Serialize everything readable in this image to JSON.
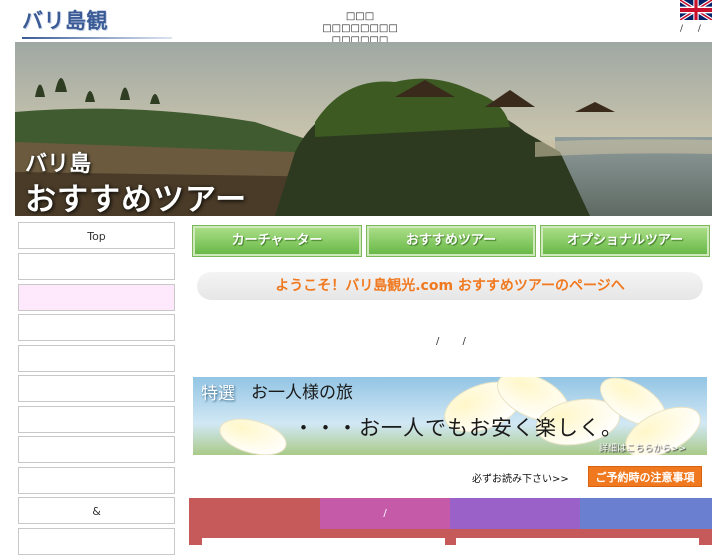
{
  "header": {
    "logo_text": "バリ島観光.com",
    "note_line1": "□□□ □□□□□□□□",
    "note_line2": "□□□□□□",
    "lang_separators": "/ /"
  },
  "hero": {
    "title_line1": "バリ島",
    "title_line2": "おすすめツアー"
  },
  "sidebar": {
    "items": [
      {
        "label": "Top"
      },
      {
        "label": ""
      },
      {
        "label": ""
      },
      {
        "label": ""
      },
      {
        "label": ""
      },
      {
        "label": ""
      },
      {
        "label": ""
      },
      {
        "label": ""
      },
      {
        "label": ""
      },
      {
        "label": "&"
      },
      {
        "label": ""
      }
    ]
  },
  "nav": {
    "car_charter": "カーチャーター",
    "recommended_tours": "おすすめツアー",
    "optional_tours": "オプショナルツアー"
  },
  "welcome": "ようこそ！バリ島観光.com おすすめツアーのページへ",
  "separators": "/ /",
  "banner": {
    "special": "特選",
    "title": "お一人様の旅",
    "tagline": "・・・お一人でもお安く楽しく。",
    "details": "詳細はこちらから>>"
  },
  "notice": {
    "read_note": "必ずお読み下さい>>",
    "caution_button": "ご予約時の注意事項"
  },
  "tabs": [
    {
      "label": "",
      "color": "#c65a5a"
    },
    {
      "label": "/",
      "color": "#c55aa8"
    },
    {
      "label": "",
      "color": "#9a62c9"
    },
    {
      "label": "",
      "color": "#6a7fcf"
    }
  ],
  "colors": {
    "accent_orange": "#f0791f",
    "nav_green": "#69b948",
    "logo_blue": "#3a5b96",
    "sidebar_active": "#fde9fb"
  }
}
